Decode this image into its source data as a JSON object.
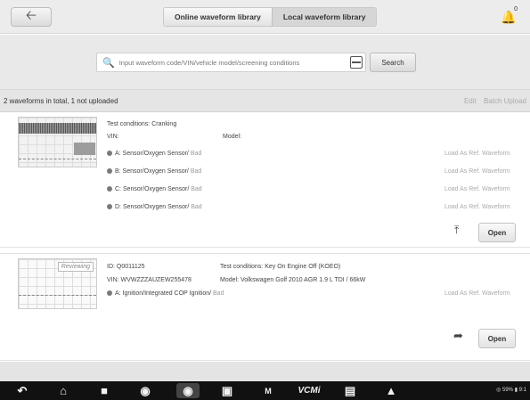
{
  "topbar": {
    "tabs": [
      {
        "label": "Online waveform library",
        "active": false
      },
      {
        "label": "Local waveform library",
        "active": true
      }
    ],
    "back_icon": "arrow-left-icon",
    "bell_icon": "bell-icon",
    "bell_badge": "0"
  },
  "search": {
    "placeholder": "Input waveform code/VIN/vehicle model/screening conditions",
    "button_label": "Search"
  },
  "summary": {
    "text": "2 waveforms in total, 1 not uploaded",
    "edit_label": "Edit",
    "batch_upload_label": "Batch Upload"
  },
  "cards": [
    {
      "test_conditions": "Test conditions: Cranking",
      "vin": "VIN:",
      "model": "Model:",
      "channels": [
        {
          "name": "A: Sensor/Oxygen Sensor/",
          "status": "Bad",
          "action": "Load As Ref. Waveform"
        },
        {
          "name": "B: Sensor/Oxygen Sensor/",
          "status": "Bad",
          "action": "Load As Ref. Waveform"
        },
        {
          "name": "C: Sensor/Oxygen Sensor/",
          "status": "Bad",
          "action": "Load As Ref. Waveform"
        },
        {
          "name": "D: Sensor/Oxygen Sensor/",
          "status": "Bad",
          "action": "Load As Ref. Waveform"
        }
      ],
      "open_label": "Open"
    },
    {
      "badge": "Reviewing",
      "id": "ID: Q0011125",
      "vin": "VIN: WVWZZZAUZEW255478",
      "test_conditions": "Test conditions: Key On Engine Off (KOEO)",
      "model": "Model: Volkswagen Golf 2010 AGR 1.9 L  TDI / 66kW",
      "channels": [
        {
          "name": "A: Ignition/Integrated COP Ignition/",
          "status": "Bad",
          "action": "Load As Ref. Waveform"
        }
      ],
      "open_label": "Open"
    }
  ],
  "navbar": {
    "icons": [
      "back-icon",
      "home-icon",
      "recent-apps-icon",
      "browser-icon",
      "camera-icon",
      "display-icon",
      "maxifix-icon",
      "vcmi-icon",
      "car-icon",
      "shop-icon"
    ],
    "m_label": "M",
    "vcmi_label": "VCMi",
    "status": "◎ 59% ▮ 9:1"
  }
}
